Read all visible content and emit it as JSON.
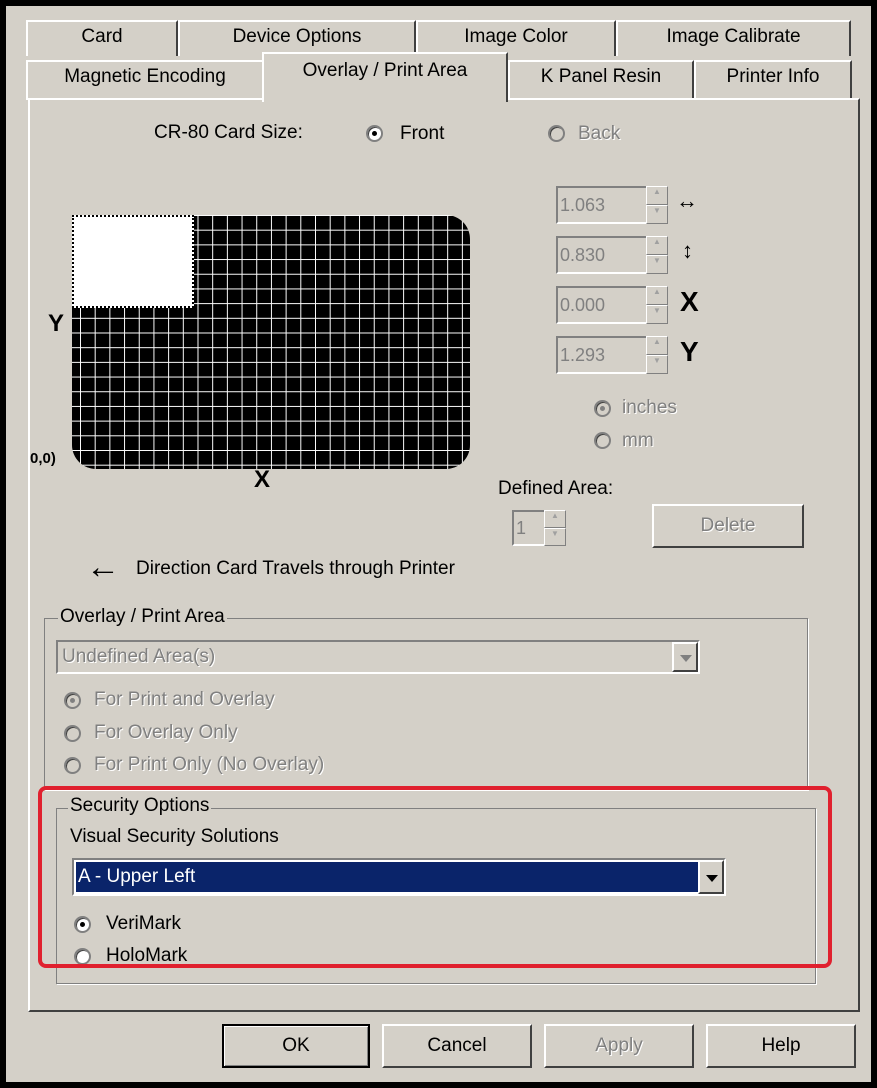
{
  "tabs_row1": [
    "Card",
    "Device Options",
    "Image Color",
    "Image Calibrate"
  ],
  "tabs_row2": [
    "Magnetic Encoding",
    "Overlay / Print Area",
    "K Panel Resin",
    "Printer Info"
  ],
  "card_size": {
    "label": "CR-80 Card Size:",
    "front": "Front",
    "back": "Back",
    "selected": "Front"
  },
  "dims": {
    "width": "1.063",
    "height": "0.830",
    "x": "0.000",
    "y": "1.293",
    "x_label": "X",
    "y_label": "Y"
  },
  "units": {
    "inches": "inches",
    "mm": "mm",
    "selected": "inches"
  },
  "diagram": {
    "y_axis": "Y",
    "x_axis": "X",
    "origin": "0,0)"
  },
  "defined_area": {
    "label": "Defined Area:",
    "value": "1",
    "delete": "Delete"
  },
  "direction_text": "Direction Card Travels through Printer",
  "overlay_group": {
    "legend": "Overlay / Print Area",
    "select_value": "Undefined Area(s)",
    "options": [
      "For Print and Overlay",
      "For Overlay Only",
      "For Print Only (No Overlay)"
    ]
  },
  "security": {
    "legend": "Security Options",
    "sub_label": "Visual Security Solutions",
    "select_value": "A - Upper Left",
    "verimark": "VeriMark",
    "holomark": "HoloMark",
    "selected": "VeriMark"
  },
  "buttons": {
    "ok": "OK",
    "cancel": "Cancel",
    "apply": "Apply",
    "help": "Help"
  },
  "colors": {
    "highlight_border": "#e0202e",
    "selection_bg": "#0a246a",
    "dialog_bg": "#d4d0c8"
  }
}
